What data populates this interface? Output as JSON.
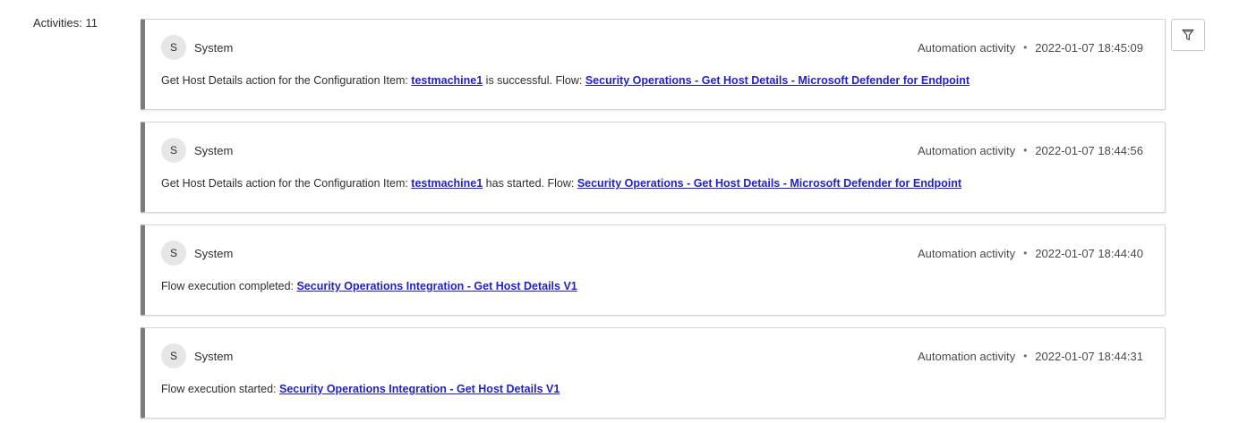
{
  "header": {
    "activities_label": "Activities: 11"
  },
  "filter": {
    "icon": "filter-icon"
  },
  "activities": [
    {
      "avatar_initial": "S",
      "author": "System",
      "type": "Automation activity",
      "separator": "•",
      "timestamp": "2022-01-07 18:45:09",
      "text_1": "Get Host Details action for the Configuration Item: ",
      "link_1": "testmachine1",
      "text_2": " is successful. Flow: ",
      "link_2": "Security Operations - Get Host Details - Microsoft Defender for Endpoint"
    },
    {
      "avatar_initial": "S",
      "author": "System",
      "type": "Automation activity",
      "separator": "•",
      "timestamp": "2022-01-07 18:44:56",
      "text_1": "Get Host Details action for the Configuration Item: ",
      "link_1": "testmachine1",
      "text_2": " has started. Flow: ",
      "link_2": "Security Operations - Get Host Details - Microsoft Defender for Endpoint"
    },
    {
      "avatar_initial": "S",
      "author": "System",
      "type": "Automation activity",
      "separator": "•",
      "timestamp": "2022-01-07 18:44:40",
      "text_1": "Flow execution completed: ",
      "link_1": "Security Operations Integration - Get Host Details V1",
      "text_2": "",
      "link_2": ""
    },
    {
      "avatar_initial": "S",
      "author": "System",
      "type": "Automation activity",
      "separator": "•",
      "timestamp": "2022-01-07 18:44:31",
      "text_1": "Flow execution started: ",
      "link_1": "Security Operations Integration - Get Host Details V1",
      "text_2": "",
      "link_2": ""
    }
  ],
  "colors": {
    "link": "#1f1fcf",
    "card_accent": "#7c7c7c",
    "avatar_bg": "#e6e6e6"
  }
}
